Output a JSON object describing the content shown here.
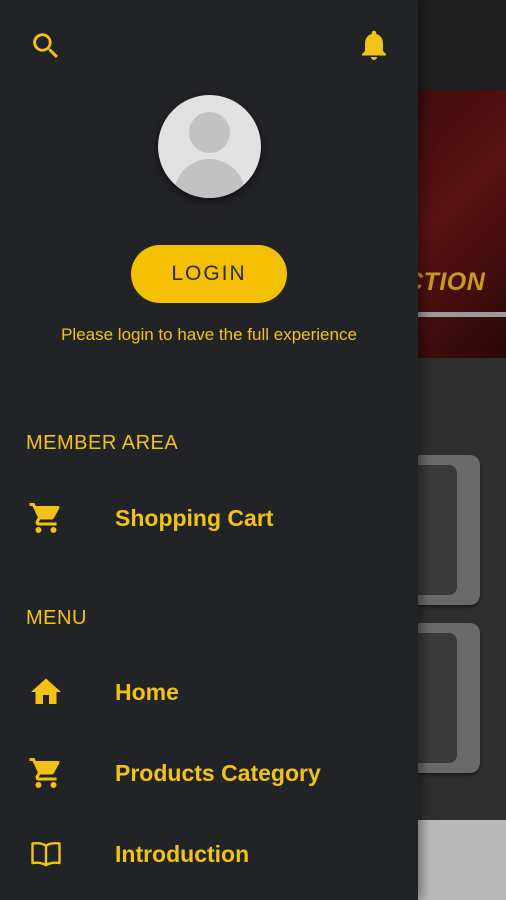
{
  "drawer": {
    "login_label": "LOGIN",
    "login_hint": "Please login to have the full experience",
    "member_area_title": "MEMBER AREA",
    "member_items": [
      {
        "label": "Shopping Cart",
        "icon": "cart-icon"
      }
    ],
    "menu_title": "MENU",
    "menu_items": [
      {
        "label": "Home",
        "icon": "home-icon"
      },
      {
        "label": "Products Category",
        "icon": "cart-icon"
      },
      {
        "label": "Introduction",
        "icon": "book-icon"
      }
    ]
  },
  "background": {
    "banner_text": "CTION"
  },
  "colors": {
    "accent": "#f3c313",
    "drawer_bg": "#222327",
    "button": "#f5c000"
  }
}
